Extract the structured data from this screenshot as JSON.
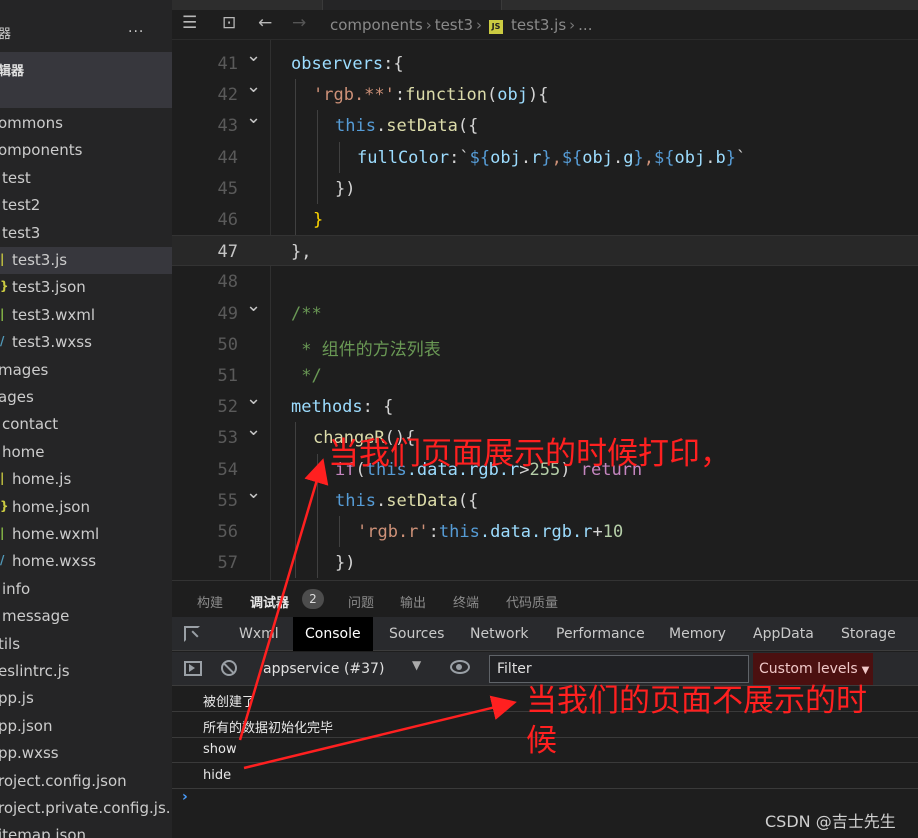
{
  "sidebar": {
    "title": "器",
    "more": "...",
    "section": "辑器",
    "items": [
      {
        "label": "ommons",
        "indent": 0,
        "icon": "",
        "icon_color": ""
      },
      {
        "label": "omponents",
        "indent": 0,
        "icon": "",
        "icon_color": ""
      },
      {
        "label": "test",
        "indent": 1,
        "icon": "",
        "icon_color": ""
      },
      {
        "label": "test2",
        "indent": 1,
        "icon": "",
        "icon_color": ""
      },
      {
        "label": "test3",
        "indent": 1,
        "icon": "",
        "icon_color": ""
      },
      {
        "label": "test3.js",
        "indent": 2,
        "icon": "js-file-icon",
        "icon_color": "#cbcb41",
        "selected": true
      },
      {
        "label": "test3.json",
        "indent": 2,
        "icon": "json-file-icon",
        "icon_color": "#cbcb41"
      },
      {
        "label": "test3.wxml",
        "indent": 2,
        "icon": "wxml-file-icon",
        "icon_color": "#8dc149"
      },
      {
        "label": "test3.wxss",
        "indent": 2,
        "icon": "wxss-file-icon",
        "icon_color": "#519aba"
      },
      {
        "label": "mages",
        "indent": 0,
        "icon": "",
        "icon_color": ""
      },
      {
        "label": "ages",
        "indent": 0,
        "icon": "",
        "icon_color": ""
      },
      {
        "label": "contact",
        "indent": 1,
        "icon": "",
        "icon_color": ""
      },
      {
        "label": "home",
        "indent": 1,
        "icon": "",
        "icon_color": ""
      },
      {
        "label": "home.js",
        "indent": 2,
        "icon": "js-file-icon",
        "icon_color": "#cbcb41"
      },
      {
        "label": "home.json",
        "indent": 2,
        "icon": "json-file-icon",
        "icon_color": "#cbcb41"
      },
      {
        "label": "home.wxml",
        "indent": 2,
        "icon": "wxml-file-icon",
        "icon_color": "#8dc149"
      },
      {
        "label": "home.wxss",
        "indent": 2,
        "icon": "wxss-file-icon",
        "icon_color": "#519aba"
      },
      {
        "label": "info",
        "indent": 1,
        "icon": "",
        "icon_color": ""
      },
      {
        "label": "message",
        "indent": 1,
        "icon": "",
        "icon_color": ""
      },
      {
        "label": "tils",
        "indent": 0,
        "icon": "",
        "icon_color": ""
      },
      {
        "label": "eslintrc.js",
        "indent": 0,
        "icon": "",
        "icon_color": ""
      },
      {
        "label": "pp.js",
        "indent": 0,
        "icon": "",
        "icon_color": ""
      },
      {
        "label": "pp.json",
        "indent": 0,
        "icon": "",
        "icon_color": ""
      },
      {
        "label": "pp.wxss",
        "indent": 0,
        "icon": "",
        "icon_color": ""
      },
      {
        "label": "roject.config.json",
        "indent": 0,
        "icon": "",
        "icon_color": ""
      },
      {
        "label": "roject.private.config.js...",
        "indent": 0,
        "icon": "",
        "icon_color": ""
      },
      {
        "label": "itemap.json",
        "indent": 0,
        "icon": "",
        "icon_color": ""
      }
    ]
  },
  "breadcrumb": {
    "parts": [
      "components",
      "test3",
      "test3.js",
      "..."
    ],
    "file_badge": "JS"
  },
  "editor": {
    "current_line": 47,
    "lines": [
      {
        "n": 41,
        "fold": true,
        "indent": 0,
        "tokens": [
          [
            "observers",
            "#9cdcfe"
          ],
          [
            ":{",
            "#d4d4d4"
          ]
        ]
      },
      {
        "n": 42,
        "fold": true,
        "indent": 1,
        "tokens": [
          [
            "'rgb.**'",
            "#ce9178"
          ],
          [
            ":",
            "#d4d4d4"
          ],
          [
            "function",
            "#dcdcaa"
          ],
          [
            "(",
            "#d4d4d4"
          ],
          [
            "obj",
            "#9cdcfe"
          ],
          [
            "){",
            "#d4d4d4"
          ]
        ]
      },
      {
        "n": 43,
        "fold": true,
        "indent": 2,
        "tokens": [
          [
            "this",
            "#569cd6"
          ],
          [
            ".",
            "#d4d4d4"
          ],
          [
            "setData",
            "#dcdcaa"
          ],
          [
            "({",
            "#d4d4d4"
          ]
        ]
      },
      {
        "n": 44,
        "fold": false,
        "indent": 3,
        "tokens": [
          [
            "fullColor",
            "#9cdcfe"
          ],
          [
            ":`",
            "#d4d4d4"
          ],
          [
            "${",
            "#569cd6"
          ],
          [
            "obj",
            "#9cdcfe"
          ],
          [
            ".",
            "#d4d4d4"
          ],
          [
            "r",
            "#9cdcfe"
          ],
          [
            "}",
            "#569cd6"
          ],
          [
            ",",
            "#ce9178"
          ],
          [
            "${",
            "#569cd6"
          ],
          [
            "obj",
            "#9cdcfe"
          ],
          [
            ".",
            "#d4d4d4"
          ],
          [
            "g",
            "#9cdcfe"
          ],
          [
            "}",
            "#569cd6"
          ],
          [
            ",",
            "#ce9178"
          ],
          [
            "${",
            "#569cd6"
          ],
          [
            "obj",
            "#9cdcfe"
          ],
          [
            ".",
            "#d4d4d4"
          ],
          [
            "b",
            "#9cdcfe"
          ],
          [
            "}",
            "#569cd6"
          ],
          [
            "`",
            "#d4d4d4"
          ]
        ]
      },
      {
        "n": 45,
        "fold": false,
        "indent": 2,
        "tokens": [
          [
            "})",
            "#d4d4d4"
          ]
        ]
      },
      {
        "n": 46,
        "fold": false,
        "indent": 1,
        "tokens": [
          [
            "}",
            "#ffd700"
          ]
        ]
      },
      {
        "n": 47,
        "fold": false,
        "indent": 0,
        "tokens": [
          [
            "},",
            "#d4d4d4"
          ]
        ]
      },
      {
        "n": 48,
        "fold": false,
        "indent": 0,
        "tokens": []
      },
      {
        "n": 49,
        "fold": true,
        "indent": 0,
        "tokens": [
          [
            "/**",
            "#6a9955"
          ]
        ]
      },
      {
        "n": 50,
        "fold": false,
        "indent": 0,
        "tokens": [
          [
            " * 组件的方法列表",
            "#6a9955"
          ]
        ]
      },
      {
        "n": 51,
        "fold": false,
        "indent": 0,
        "tokens": [
          [
            " */",
            "#6a9955"
          ]
        ]
      },
      {
        "n": 52,
        "fold": true,
        "indent": 0,
        "tokens": [
          [
            "methods",
            "#9cdcfe"
          ],
          [
            ": {",
            "#d4d4d4"
          ]
        ]
      },
      {
        "n": 53,
        "fold": true,
        "indent": 1,
        "tokens": [
          [
            "changeR",
            "#dcdcaa"
          ],
          [
            "(){",
            "#d4d4d4"
          ]
        ]
      },
      {
        "n": 54,
        "fold": false,
        "indent": 2,
        "tokens": [
          [
            "if",
            "#c586c0"
          ],
          [
            "(",
            "#d4d4d4"
          ],
          [
            "this",
            "#569cd6"
          ],
          [
            ".data.rgb.r",
            "#9cdcfe"
          ],
          [
            ">",
            "#d4d4d4"
          ],
          [
            "255",
            "#b5cea8"
          ],
          [
            ") ",
            "#d4d4d4"
          ],
          [
            "return",
            "#c586c0"
          ]
        ]
      },
      {
        "n": 55,
        "fold": true,
        "indent": 2,
        "tokens": [
          [
            "this",
            "#569cd6"
          ],
          [
            ".",
            "#d4d4d4"
          ],
          [
            "setData",
            "#dcdcaa"
          ],
          [
            "({",
            "#d4d4d4"
          ]
        ]
      },
      {
        "n": 56,
        "fold": false,
        "indent": 3,
        "tokens": [
          [
            "'rgb.r'",
            "#ce9178"
          ],
          [
            ":",
            "#d4d4d4"
          ],
          [
            "this",
            "#569cd6"
          ],
          [
            ".data.rgb.r",
            "#9cdcfe"
          ],
          [
            "+",
            "#d4d4d4"
          ],
          [
            "10",
            "#b5cea8"
          ]
        ]
      },
      {
        "n": 57,
        "fold": false,
        "indent": 2,
        "tokens": [
          [
            "})",
            "#d4d4d4"
          ]
        ]
      }
    ]
  },
  "panel": {
    "tabs": [
      {
        "label": "构建",
        "active": false
      },
      {
        "label": "调试器",
        "active": true,
        "badge": "2"
      },
      {
        "label": "问题",
        "active": false
      },
      {
        "label": "输出",
        "active": false
      },
      {
        "label": "终端",
        "active": false
      },
      {
        "label": "代码质量",
        "active": false
      }
    ],
    "devtools_tabs": [
      "Wxml",
      "Console",
      "Sources",
      "Network",
      "Performance",
      "Memory",
      "AppData",
      "Storage"
    ],
    "devtools_active": "Console",
    "context": "appservice (#37)",
    "filter_placeholder": "Filter",
    "levels": "Custom levels",
    "console_lines": [
      "被创建了",
      "所有的数据初始化完毕",
      "show",
      "hide"
    ],
    "prompt": "›"
  },
  "annotations": {
    "show_note": "当我们页面展示的时候打印，",
    "hide_note_line1": "当我们的页面不展示的时",
    "hide_note_line2": "候",
    "color": "#ff2020"
  },
  "watermark": "CSDN @吉士先生",
  "colors": {
    "editor_bg": "#1e1e1e",
    "sidebar_bg": "#252526",
    "devtools_bg": "#292a2d",
    "levels_bg": "#4b1010"
  }
}
